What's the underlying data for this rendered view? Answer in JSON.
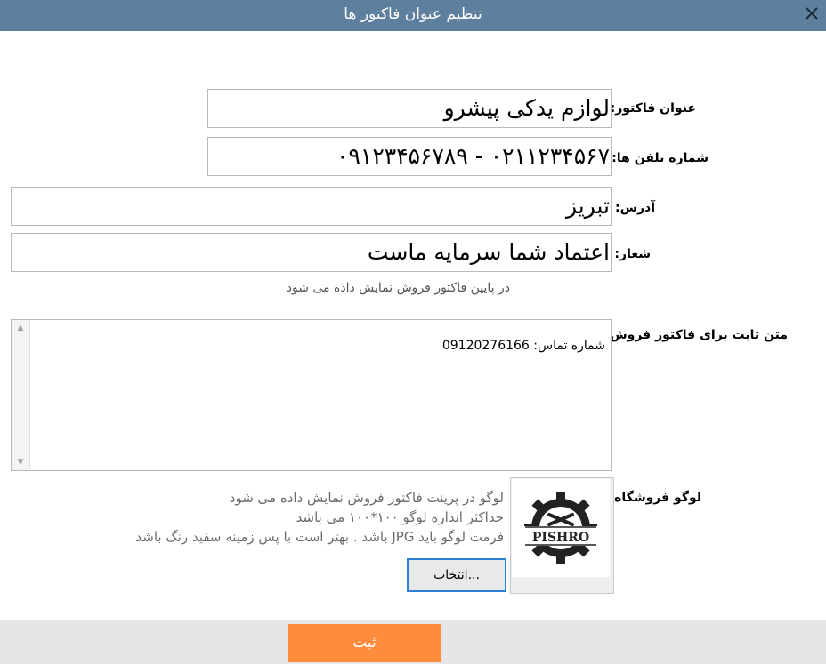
{
  "window": {
    "title": "تنظیم عنوان فاکتور ها",
    "close_icon": "close-icon"
  },
  "form": {
    "title_label": "عنوان فاکتور:",
    "title_value": "لوازم یدکی پیشرو",
    "phone_label": "شماره تلفن ها:",
    "phone_value": "۰۲۱۱۲۳۴۵۶۷ - ۰۹۱۲۳۴۵۶۷۸۹",
    "address_label": "آدرس:",
    "address_value": "تبریز",
    "slogan_label": "شعار:",
    "slogan_value": "اعتماد شما سرمایه ماست",
    "slogan_hint": "در پایین فاکتور فروش نمایش داده می شود",
    "fixed_text_label": "متن ثابت برای فاکتور فروش:",
    "fixed_text_value": "شماره تماس: 09120276166"
  },
  "logo": {
    "label": "لوگو فروشگاه:",
    "logo_text": "PISHRO",
    "notes": [
      "لوگو در پرینت فاکتور فروش نمایش داده می شود",
      "حداکثر اندازه لوگو ۱۰۰*۱۰۰ می باشد",
      "فرمت لوگو باید JPG باشد . بهتر است با پس زمینه سفید رنگ باشد"
    ],
    "choose_button": "انتخاب..."
  },
  "footer": {
    "submit_button": "ثبت"
  },
  "colors": {
    "titlebar": "#5f7f9e",
    "submit": "#ff8c3c",
    "choose_border": "#2c7fd4"
  }
}
